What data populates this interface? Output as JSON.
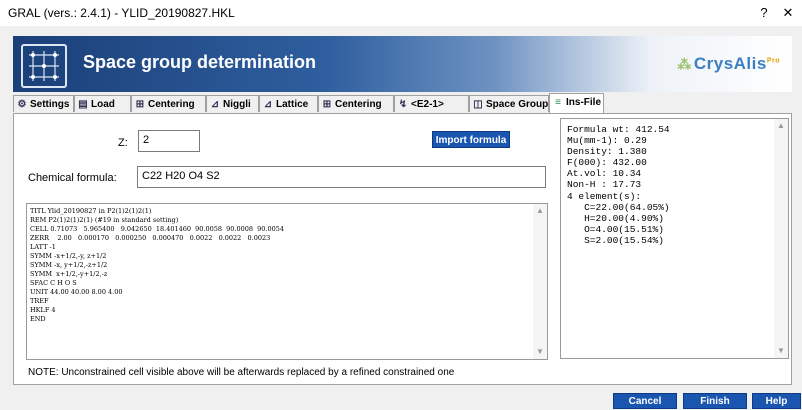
{
  "window": {
    "title": "GRAL (vers.: 2.4.1) - YLID_20190827.HKL",
    "help_label": "?",
    "close_label": "✕"
  },
  "banner": {
    "title": "Space group determination",
    "brand": "CrysAlis",
    "brand_sup": "Pro"
  },
  "tabs": [
    {
      "label": "Settings",
      "icon": "gear-icon"
    },
    {
      "label": "Load",
      "icon": "load-icon"
    },
    {
      "label": "Centering",
      "icon": "centering-icon"
    },
    {
      "label": "Niggli",
      "icon": "niggli-icon"
    },
    {
      "label": "Lattice",
      "icon": "lattice-icon"
    },
    {
      "label": "Centering",
      "icon": "centering-icon"
    },
    {
      "label": "<E2-1>",
      "icon": "e2-icon"
    },
    {
      "label": "Space Group",
      "icon": "space-group-icon"
    },
    {
      "label": "Ins-File",
      "icon": "ins-file-icon",
      "active": true
    }
  ],
  "form": {
    "z_label": "Z:",
    "z_value": "2",
    "import_label": "Import formula",
    "formula_label": "Chemical formula:",
    "formula_value": "C22 H20 O4 S2"
  },
  "ins_file": "TITL Ylid_20190827 in P2(1)2(1)2(1)\nREM P2(1)2(1)2(1) (#19 in standard setting)\nCELL 0.71073   5.965400   9.042650  18.401460  90.0058  90.0008  90.0054\nZERR    2.00   0.000170   0.000250   0.000470   0.0022   0.0022   0.0023\nLATT -1\nSYMM -x+1/2,-y, z+1/2\nSYMM -x, y+1/2,-z+1/2\nSYMM  x+1/2,-y+1/2,-z\nSFAC C H O S\nUNIT 44.00 40.00 8.00 4.00\nTREF\nHKLF 4\nEND",
  "info": "Formula wt: 412.54\nMu(mm-1): 0.29\nDensity: 1.380\nF(000): 432.00\nAt.vol: 10.34\nNon-H : 17.73\n4 element(s):\n   C=22.00(64.05%)\n   H=20.00(4.90%)\n   O=4.00(15.51%)\n   S=2.00(15.54%)",
  "note": "NOTE: Unconstrained cell visible above will be afterwards replaced by a refined constrained one",
  "buttons": {
    "cancel": "Cancel",
    "finish": "Finish",
    "help": "Help"
  }
}
